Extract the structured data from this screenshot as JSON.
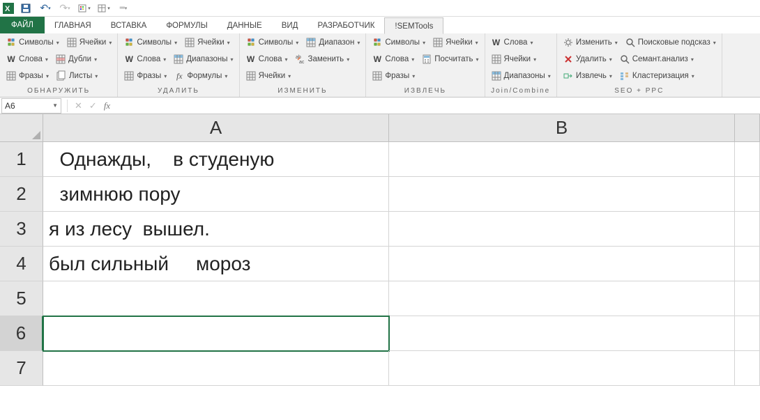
{
  "qat": {
    "undo_tip": "↶",
    "redo_tip": "↷"
  },
  "tabs": {
    "file": "ФАЙЛ",
    "home": "ГЛАВНАЯ",
    "insert": "ВСТАВКА",
    "formulas": "ФОРМУЛЫ",
    "data": "ДАННЫЕ",
    "view": "ВИД",
    "developer": "РАЗРАБОТЧИК",
    "semtools": "!SEMTools"
  },
  "ribbon": {
    "groups": [
      {
        "label": "ОБНАРУЖИТЬ",
        "cols": [
          [
            "Символы",
            "Слова",
            "Фразы"
          ],
          [
            "Ячейки",
            "Дубли",
            "Листы"
          ]
        ]
      },
      {
        "label": "УДАЛИТЬ",
        "cols": [
          [
            "Символы",
            "Слова",
            "Фразы"
          ],
          [
            "Ячейки",
            "Диапазоны",
            "Формулы"
          ]
        ]
      },
      {
        "label": "ИЗМЕНИТЬ",
        "cols": [
          [
            "Символы",
            "Слова",
            "Ячейки"
          ],
          [
            "Диапазон",
            "Заменить",
            ""
          ]
        ]
      },
      {
        "label": "ИЗВЛЕЧЬ",
        "cols": [
          [
            "Символы",
            "Слова",
            "Фразы"
          ],
          [
            "Ячейки",
            "Посчитать",
            ""
          ]
        ]
      },
      {
        "label": "Join/Combine",
        "cols": [
          [
            "Слова",
            "Ячейки",
            "Диапазоны"
          ]
        ]
      },
      {
        "label": "SEO + PPC",
        "cols": [
          [
            "Изменить",
            "Удалить",
            "Извлечь"
          ],
          [
            "Поисковые подсказ",
            "Семант.анализ",
            "Кластеризация"
          ]
        ]
      }
    ]
  },
  "namebox": "A6",
  "formula": "",
  "columns": [
    "A",
    "B"
  ],
  "rows": [
    "1",
    "2",
    "3",
    "4",
    "5",
    "6",
    "7"
  ],
  "cells": {
    "A1": "  Однажды,    в студеную",
    "A2": "  зимнюю пору",
    "A3": "я из лесу  вышел.",
    "A4": "был сильный     мороз",
    "A5": "",
    "A6": "",
    "A7": ""
  },
  "active_cell": "A6",
  "W": "W",
  "fx": "fx",
  "abc": "abc"
}
